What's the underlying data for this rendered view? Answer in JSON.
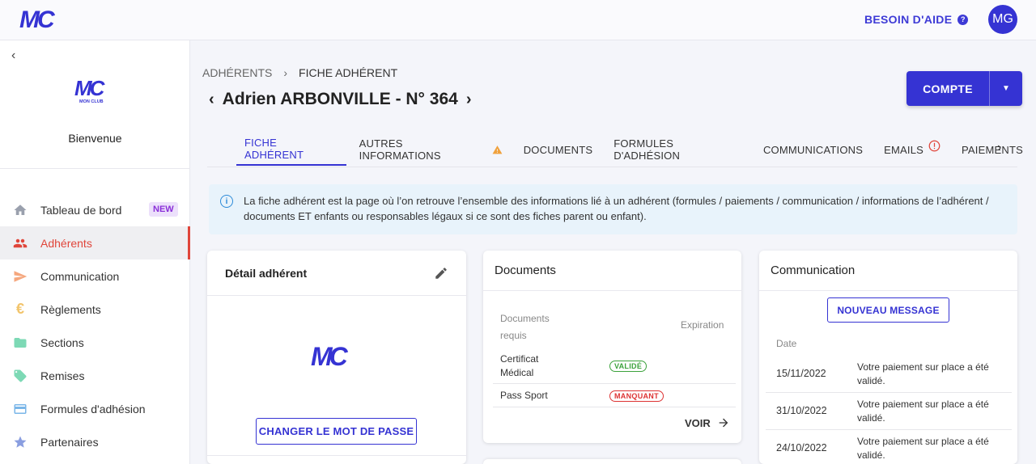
{
  "topbar": {
    "help_label": "BESOIN D'AIDE",
    "help_icon": "?",
    "avatar_initials": "MG"
  },
  "sidebar": {
    "welcome": "Bienvenue",
    "logo_subtitle": "MON CLUB",
    "items": [
      {
        "label": "Tableau de bord",
        "icon": "home-icon",
        "badge": "NEW"
      },
      {
        "label": "Adhérents",
        "icon": "people-icon"
      },
      {
        "label": "Communication",
        "icon": "send-icon"
      },
      {
        "label": "Règlements",
        "icon": "euro-icon"
      },
      {
        "label": "Sections",
        "icon": "folder-icon"
      },
      {
        "label": "Remises",
        "icon": "tag-icon"
      },
      {
        "label": "Formules d'adhésion",
        "icon": "card-icon"
      },
      {
        "label": "Partenaires",
        "icon": "star-icon"
      }
    ],
    "colors": {
      "active": "#e0453a",
      "home": "#9aa0ad",
      "send": "#f5a77e",
      "euro": "#f2c46b",
      "folder": "#7dd9b5",
      "tag": "#7dd9b5",
      "card": "#7ab6e8",
      "star": "#8a9ee0"
    }
  },
  "breadcrumb": {
    "parent": "ADHÉRENTS",
    "current": "FICHE ADHÉRENT"
  },
  "page_title": "Adrien ARBONVILLE - N° 364",
  "compte_button": "COMPTE",
  "tabs": [
    {
      "label": "FICHE ADHÉRENT",
      "active": true
    },
    {
      "label": "AUTRES INFORMATIONS",
      "icon": "warning-icon"
    },
    {
      "label": "DOCUMENTS"
    },
    {
      "label": "FORMULES D'ADHÉSION"
    },
    {
      "label": "COMMUNICATIONS"
    },
    {
      "label": "EMAILS",
      "icon": "alert-icon"
    },
    {
      "label": "PAIEMENTS"
    }
  ],
  "info_banner": {
    "line1": "La fiche adhérent est la page où l’on retrouve l’ensemble des informations lié à un adhérent (formules / paiements / communication / informations de l’adhérent /",
    "line2": "documents ET enfants ou responsables légaux si ce sont des fiches parent ou enfant)."
  },
  "detail_card": {
    "title": "Détail adhérent",
    "password_button": "CHANGER LE MOT DE PASSE"
  },
  "documents_card": {
    "title": "Documents",
    "col_required": "Documents requis",
    "col_expiration": "Expiration",
    "rows": [
      {
        "name": "Certificat Médical",
        "status": "VALIDÉ"
      },
      {
        "name": "Pass Sport",
        "status": "MANQUANT"
      }
    ],
    "voir": "VOIR"
  },
  "communication_card": {
    "title": "Communication",
    "new_message": "NOUVEAU MESSAGE",
    "col_date": "Date",
    "rows": [
      {
        "date": "15/11/2022",
        "text": "Votre paiement sur place a été validé."
      },
      {
        "date": "31/10/2022",
        "text": "Votre paiement sur place a été validé."
      },
      {
        "date": "24/10/2022",
        "text": "Votre paiement sur place a été validé."
      }
    ]
  },
  "brand": {
    "primary": "#3533d3",
    "logo_text": "MC"
  }
}
